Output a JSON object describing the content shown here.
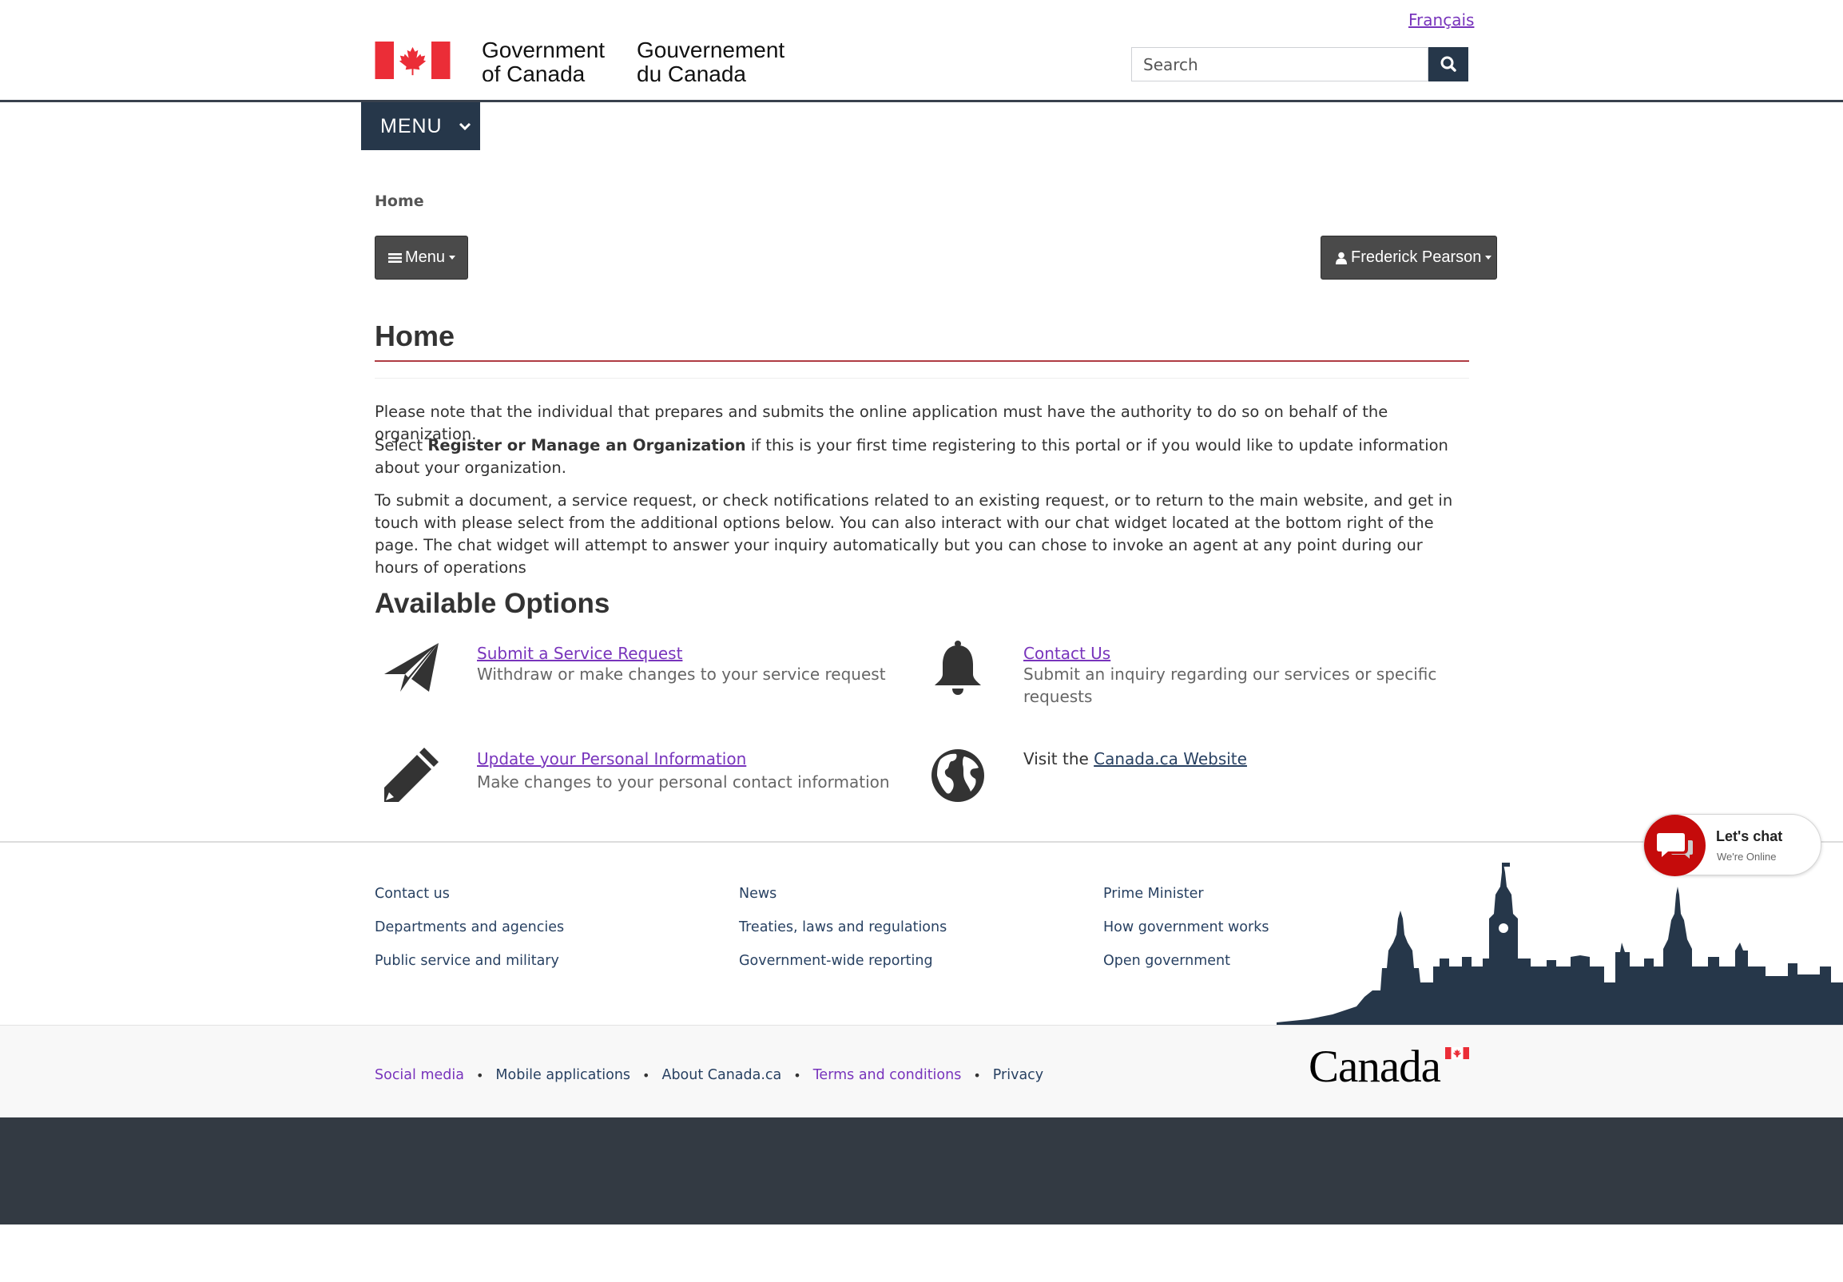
{
  "header": {
    "language_link": "Français",
    "signature_en_line1": "Government",
    "signature_en_line2": "of Canada",
    "signature_fr_line1": "Gouvernement",
    "signature_fr_line2": "du Canada",
    "search_placeholder": "Search",
    "menu_label": "MENU"
  },
  "breadcrumb": {
    "home": "Home"
  },
  "app_bar": {
    "menu_label": "Menu",
    "user_name": "Frederick Pearson"
  },
  "main": {
    "title": "Home",
    "paragraph1": "Please note that the individual that prepares and submits the online application must have the authority to do so on behalf of the organization.",
    "paragraph2_prefix": "Select ",
    "paragraph2_bold": "Register or Manage an Organization",
    "paragraph2_suffix": " if this is your first time registering to this portal or if you would like to update information about your organization.",
    "paragraph3": "To submit a document, a service request, or check notifications related to an existing request, or to return to the main website, and get in touch with please select from the additional options below. You can also interact with our chat widget located at the bottom right of the page. The chat widget will attempt to answer your inquiry automatically but you can chose to invoke an agent at any point during our hours of operations",
    "options_title": "Available Options",
    "options": [
      {
        "icon": "paper-plane-icon",
        "link": "Submit a Service Request",
        "desc": "Withdraw or make changes to your service request"
      },
      {
        "icon": "bell-icon",
        "link": "Contact Us",
        "desc": "Submit an inquiry regarding our services or specific requests"
      },
      {
        "icon": "pencil-icon",
        "link": "Update your Personal Information",
        "desc": "Make changes to your personal contact information"
      },
      {
        "icon": "globe-icon",
        "prefix": "Visit the ",
        "link": "Canada.ca Website"
      }
    ]
  },
  "footer": {
    "col1": [
      "Contact us",
      "Departments and agencies",
      "Public service and military"
    ],
    "col2": [
      "News",
      "Treaties, laws and regulations",
      "Government-wide reporting"
    ],
    "col3": [
      "Prime Minister",
      "How government works",
      "Open government"
    ],
    "bottom_links": [
      "Social media",
      "Mobile applications",
      "About Canada.ca",
      "Terms and conditions",
      "Privacy"
    ],
    "wordmark": "Canada"
  },
  "chat": {
    "title": "Let's chat",
    "status": "We're Online"
  },
  "colors": {
    "navy": "#26374a",
    "visited_link": "#7834bc",
    "link": "#284162",
    "accent_red": "#af3c43",
    "chat_red": "#c50b0b",
    "footer_dark": "#333a43"
  }
}
